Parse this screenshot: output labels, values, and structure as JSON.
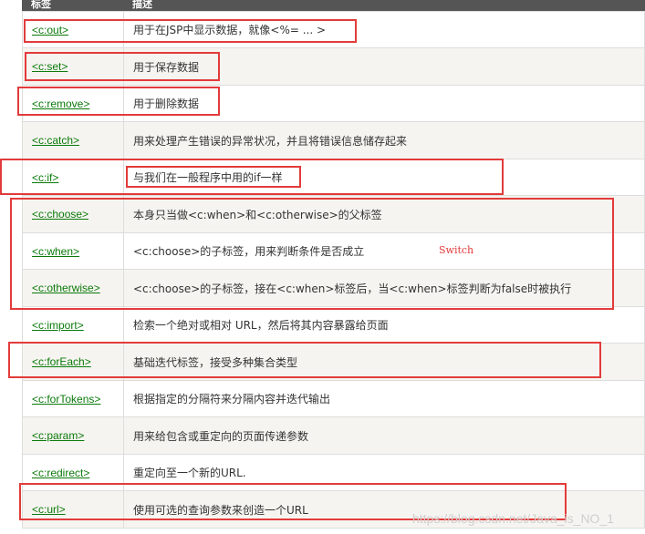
{
  "header": {
    "tag": "标签",
    "description": "描述"
  },
  "rows": [
    {
      "tag": "<c:out>",
      "description": "用于在JSP中显示数据，就像<%= ... >"
    },
    {
      "tag": "<c:set>",
      "description": "用于保存数据"
    },
    {
      "tag": "<c:remove>",
      "description": "用于删除数据"
    },
    {
      "tag": "<c:catch>",
      "description": "用来处理产生错误的异常状况，并且将错误信息储存起来"
    },
    {
      "tag": "<c:if>",
      "description": "与我们在一般程序中用的if一样"
    },
    {
      "tag": "<c:choose>",
      "description": "本身只当做<c:when>和<c:otherwise>的父标签"
    },
    {
      "tag": "<c:when>",
      "description": "<c:choose>的子标签，用来判断条件是否成立"
    },
    {
      "tag": "<c:otherwise>",
      "description": "<c:choose>的子标签，接在<c:when>标签后，当<c:when>标签判断为false时被执行"
    },
    {
      "tag": "<c:import>",
      "description": "检索一个绝对或相对 URL，然后将其内容暴露给页面"
    },
    {
      "tag": "<c:forEach>",
      "description": "基础迭代标签，接受多种集合类型"
    },
    {
      "tag": "<c:forTokens>",
      "description": "根据指定的分隔符来分隔内容并迭代输出"
    },
    {
      "tag": "<c:param>",
      "description": "用来给包含或重定向的页面传递参数"
    },
    {
      "tag": "<c:redirect>",
      "description": "重定向至一个新的URL."
    },
    {
      "tag": "<c:url>",
      "description": "使用可选的查询参数来创造一个URL"
    }
  ],
  "annotation": {
    "switch_label": "Switch"
  },
  "watermark": "https://blog.csdn.net/Java_is_NO_1",
  "colors": {
    "highlight": "#e23b3b",
    "link": "#0b7a0b",
    "row_alt": "#f6f4f0"
  }
}
